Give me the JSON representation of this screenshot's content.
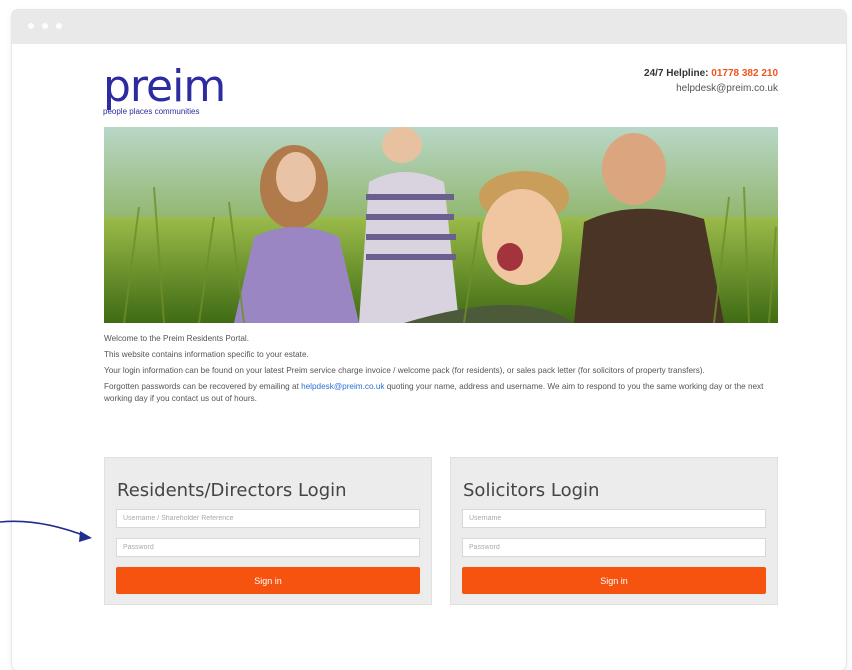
{
  "window": {
    "controls": [
      "close",
      "minimize",
      "maximize"
    ]
  },
  "brand": {
    "logo_text": "preim",
    "tagline": "people places communities",
    "color": "#2c2ba0"
  },
  "header": {
    "helpline_label": "24/7 Helpline:",
    "helpline_number": "01778 382 210",
    "email": "helpdesk@preim.co.uk",
    "accent": "#f0541a"
  },
  "hero": {
    "alt": "Family in a grassy meadow"
  },
  "intro": {
    "p1": "Welcome to the Preim Residents Portal.",
    "p2": "This website contains information specific to your estate.",
    "p3": "Your login information can be found on your latest Preim service charge invoice / welcome pack (for residents), or sales pack letter (for solicitors of property transfers).",
    "p4_before": "Forgotten passwords can be recovered by emailing at ",
    "p4_link": "helpdesk@preim.co.uk",
    "p4_after": " quoting your name, address and username. We aim to respond to you the same working day or the next working day if you contact us out of hours."
  },
  "residents_login": {
    "title": "Residents/Directors Login",
    "username_placeholder": "Username / Shareholder Reference",
    "password_placeholder": "Password",
    "submit": "Sign in"
  },
  "solicitors_login": {
    "title": "Solicitors Login",
    "username_placeholder": "Username",
    "password_placeholder": "Password",
    "submit": "Sign in"
  },
  "colors": {
    "button": "#f5530f",
    "annotation_arrow": "#1f2d8f"
  }
}
